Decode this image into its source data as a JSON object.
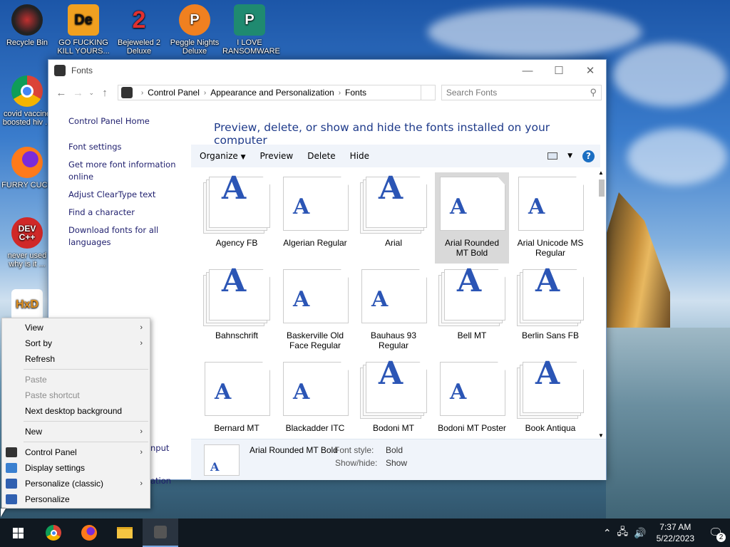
{
  "desktop": {
    "icons": [
      {
        "label": "Recycle Bin",
        "glyph": ""
      },
      {
        "label": "GO FUCKING KILL YOURS...",
        "glyph": "De"
      },
      {
        "label": "Bejeweled 2 Deluxe",
        "glyph": "2"
      },
      {
        "label": "Peggle Nights Deluxe",
        "glyph": "P"
      },
      {
        "label": "I LOVE RANSOMWARE",
        "glyph": "P"
      },
      {
        "label": "covid vaccine boosted hiv ...",
        "glyph": ""
      },
      {
        "label": "FURRY CUCK",
        "glyph": ""
      },
      {
        "label": "never used why is it ...",
        "glyph": "DEV C++"
      },
      {
        "label": "",
        "glyph": "HxD"
      }
    ]
  },
  "window": {
    "title": "Fonts",
    "breadcrumb": [
      "Control Panel",
      "Appearance and Personalization",
      "Fonts"
    ],
    "search_placeholder": "Search Fonts",
    "left_pane": {
      "home": "Control Panel Home",
      "links": [
        "Font settings",
        "Get more font information online",
        "Adjust ClearType text",
        "Find a character",
        "Download fonts for all languages"
      ]
    },
    "headline": "Preview, delete, or show and hide the fonts installed on your computer",
    "commands": [
      "Organize",
      "Preview",
      "Delete",
      "Hide"
    ],
    "fonts": [
      {
        "name": "Agency FB",
        "family": true
      },
      {
        "name": "Algerian Regular",
        "family": false
      },
      {
        "name": "Arial",
        "family": true
      },
      {
        "name": "Arial Rounded MT Bold",
        "family": false,
        "selected": true
      },
      {
        "name": "Arial Unicode MS Regular",
        "family": false
      },
      {
        "name": "Bahnschrift",
        "family": true
      },
      {
        "name": "Baskerville Old Face Regular",
        "family": false
      },
      {
        "name": "Bauhaus 93 Regular",
        "family": false
      },
      {
        "name": "Bell MT",
        "family": true
      },
      {
        "name": "Berlin Sans FB",
        "family": true
      },
      {
        "name": "Bernard MT",
        "family": false
      },
      {
        "name": "Blackadder ITC",
        "family": false
      },
      {
        "name": "Bodoni MT",
        "family": true
      },
      {
        "name": "Bodoni MT Poster",
        "family": false
      },
      {
        "name": "Book Antiqua",
        "family": true
      }
    ],
    "details": {
      "name": "Arial Rounded MT Bold",
      "style_label": "Font style:",
      "style_value": "Bold",
      "showhide_label": "Show/hide:",
      "showhide_value": "Show"
    },
    "peek_texts": [
      "nput",
      "ation"
    ]
  },
  "context_menu": {
    "items": [
      {
        "label": "View",
        "submenu": true,
        "disabled": false
      },
      {
        "label": "Sort by",
        "submenu": true,
        "disabled": false
      },
      {
        "label": "Refresh",
        "submenu": false,
        "disabled": false
      },
      {
        "sep": true
      },
      {
        "label": "Paste",
        "submenu": false,
        "disabled": true
      },
      {
        "label": "Paste shortcut",
        "submenu": false,
        "disabled": true
      },
      {
        "label": "Next desktop background",
        "submenu": false,
        "disabled": false
      },
      {
        "sep": true
      },
      {
        "label": "New",
        "submenu": true,
        "disabled": false
      },
      {
        "sep": true
      },
      {
        "label": "Control Panel",
        "submenu": true,
        "disabled": false,
        "icon": "control-panel-icon"
      },
      {
        "label": "Display settings",
        "submenu": false,
        "disabled": false,
        "icon": "display-icon"
      },
      {
        "label": "Personalize (classic)",
        "submenu": true,
        "disabled": false,
        "icon": "personalize-icon"
      },
      {
        "label": "Personalize",
        "submenu": false,
        "disabled": false,
        "icon": "personalize-icon"
      }
    ]
  },
  "taskbar": {
    "time": "7:37 AM",
    "date": "5/22/2023",
    "notification_count": "2"
  }
}
